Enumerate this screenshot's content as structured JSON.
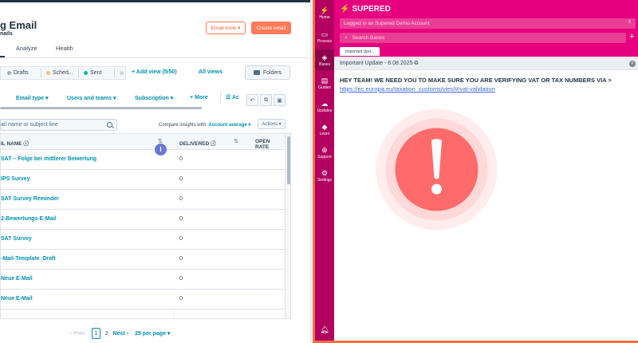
{
  "left_app": {
    "title": "g Email",
    "subtitle": "nails",
    "email_tools_label": "Email tools",
    "create_email_label": "Create email",
    "main_tabs": [
      "Analyze",
      "Health"
    ],
    "view_tabs": [
      {
        "label": "Drafts",
        "color": "#99acc2"
      },
      {
        "label": "Sched...",
        "color": "#f5c26b"
      },
      {
        "label": "Sent",
        "color": "#00bda5"
      },
      {
        "label": "",
        "color": "#cbd6e2"
      }
    ],
    "add_view_label": "Add view (5/50)",
    "all_views_label": "All views",
    "folders_label": "Folders",
    "filters": [
      "Email type",
      "Users and teams",
      "Subscription",
      "More"
    ],
    "adv_filter_label": "Ac",
    "search_placeholder": "ail name or subject line",
    "compare_label": "Compare insights with:",
    "compare_value": "Account average",
    "actions_label": "Actions",
    "columns": [
      "IL NAME",
      "DELIVERED",
      "OPEN RATE"
    ],
    "tooltip_badge": "I",
    "rows": [
      {
        "name": "SAT – Folge bei mittlerer Bewertung",
        "delivered": "0"
      },
      {
        "name": "IPS Survey",
        "delivered": "0"
      },
      {
        "name": "SAT Survey Reminder",
        "delivered": "0"
      },
      {
        "name": "2-Bewertungs-E-Mail",
        "delivered": "0"
      },
      {
        "name": "SAT Survey",
        "delivered": "0"
      },
      {
        "name": "-Mail-Template_Draft",
        "delivered": "0"
      },
      {
        "name": "Neue E-Mail",
        "delivered": "0"
      },
      {
        "name": "Neue E-Mail",
        "delivered": "0"
      }
    ],
    "pagination": {
      "prev": "Prev",
      "current": "1",
      "next_page": "2",
      "next": "Next",
      "page_size": "25 per page"
    }
  },
  "supered": {
    "brand": "SUPERED",
    "nav": [
      {
        "label": "Home",
        "glyph": "⚡"
      },
      {
        "label": "Process",
        "glyph": "▭"
      },
      {
        "label": "Bases",
        "glyph": "◈"
      },
      {
        "label": "Guides",
        "glyph": "▤"
      },
      {
        "label": "Updates",
        "glyph": "☁"
      },
      {
        "label": "Learn",
        "glyph": "◆"
      },
      {
        "label": "Support",
        "glyph": "⊕"
      },
      {
        "label": "Settings",
        "glyph": "⚙"
      }
    ],
    "account_text": "Logged in as Supered Demo Account",
    "search_placeholder": "Search Bases",
    "chip_label": "Important Upd...",
    "notice_title": "Important Update - 6.08.2025",
    "message": "HEY TEAM! WE NEED YOU TO MAKE SURE YOU ARE VERIFYING VAT OR TAX NUMBERS VIA >",
    "link": "https://ec.europa.eu/taxation_customs/vies/#/vat-validation",
    "colors": {
      "sidebar": "#b1005f",
      "header": "#e6007e",
      "alert": "#ff6b6b",
      "outline": "#ff6e3a"
    }
  }
}
